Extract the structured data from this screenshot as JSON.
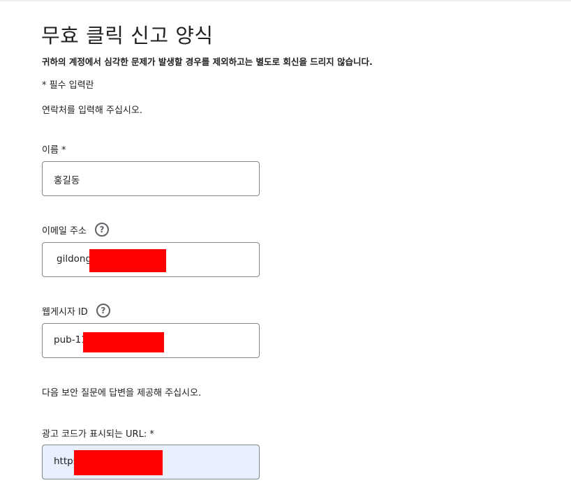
{
  "form": {
    "title": "무효 클릭 신고 양식",
    "warning": "귀하의 계정에서 심각한 문제가 발생할 경우를 제외하고는 별도로 회신을 드리지 않습니다.",
    "required_note": "* 필수 입력란",
    "contact_prompt": "연락처를 입력해 주십시오.",
    "security_prompt": "다음 보안 질문에 답변을 제공해 주십시오."
  },
  "fields": {
    "name": {
      "label": "이름 *",
      "value": "홍길동"
    },
    "email": {
      "label": "이메일 주소",
      "value": "gildong",
      "help_icon": "?"
    },
    "publisher_id": {
      "label": "웹게시자 ID",
      "value": "pub-11",
      "help_icon": "?"
    },
    "url": {
      "label": "광고 코드가 표시되는 URL: *",
      "value": "https"
    }
  },
  "colors": {
    "redaction": "#ff0000",
    "autofill_bg": "#e8f0fe",
    "border": "#80868b"
  }
}
